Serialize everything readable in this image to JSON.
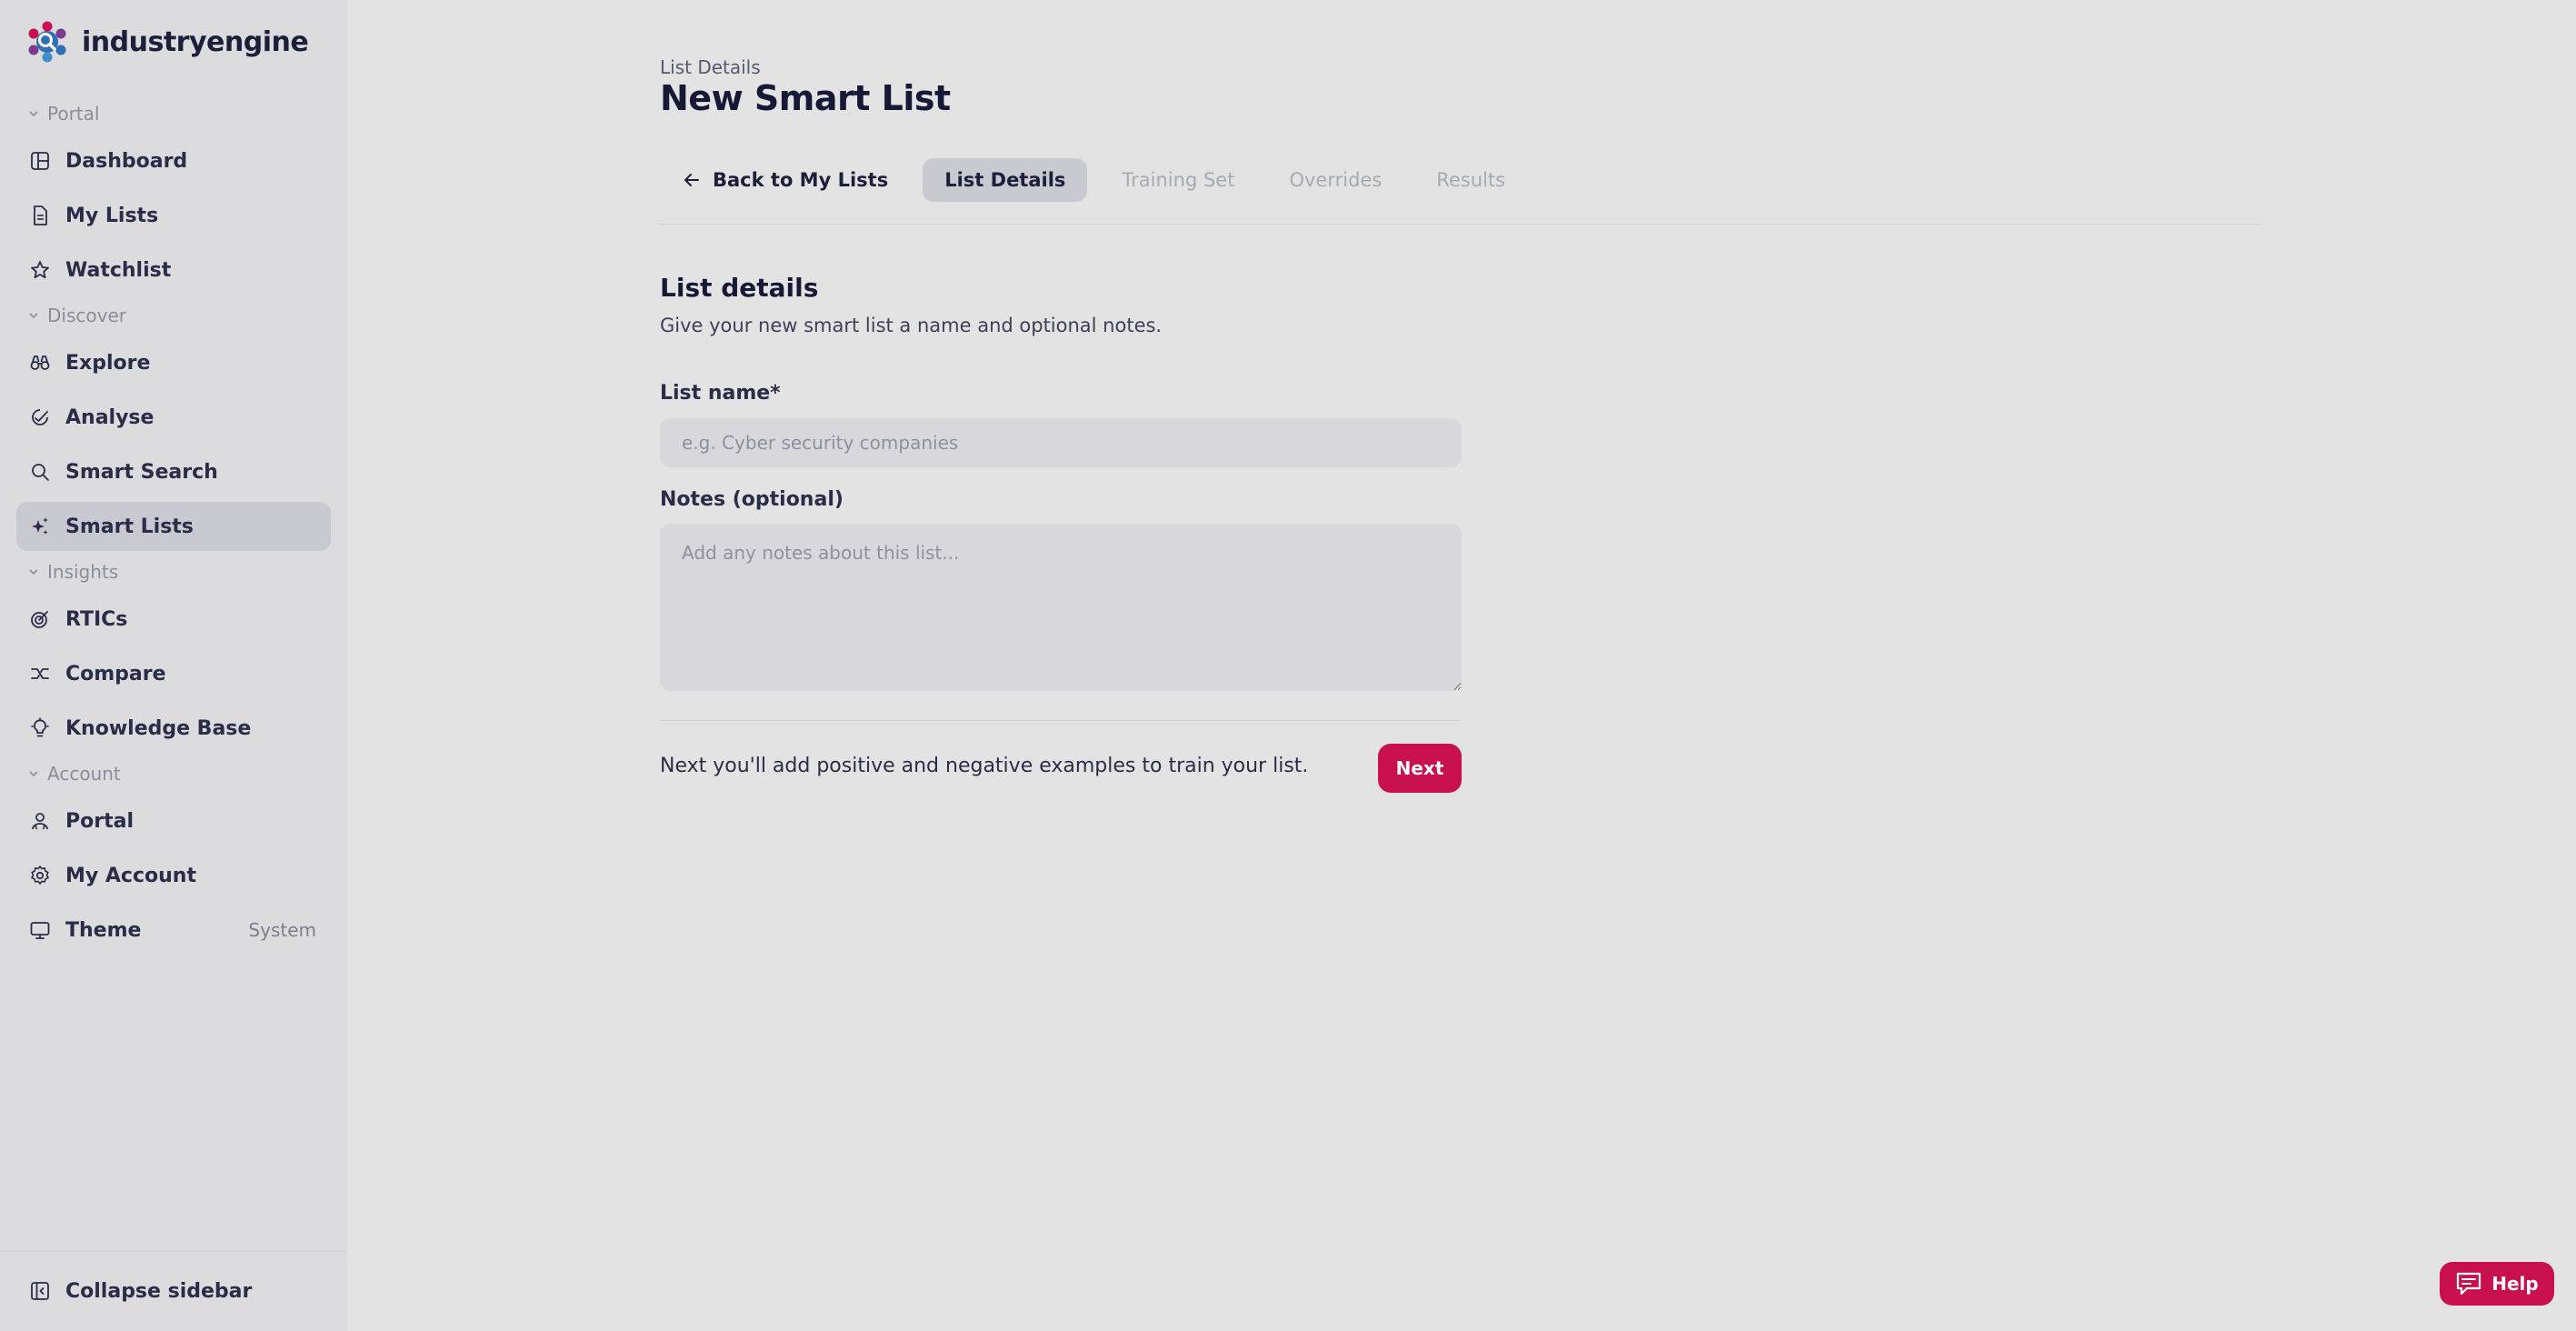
{
  "app": {
    "name": "industryengine"
  },
  "sidebar": {
    "sections": {
      "portal": "Portal",
      "discover": "Discover",
      "insights": "Insights",
      "account": "Account"
    },
    "items": {
      "dashboard": "Dashboard",
      "my_lists": "My Lists",
      "watchlist": "Watchlist",
      "explore": "Explore",
      "analyse": "Analyse",
      "smart_search": "Smart Search",
      "smart_lists": "Smart Lists",
      "rtics": "RTICs",
      "compare": "Compare",
      "knowledge_base": "Knowledge Base",
      "portal": "Portal",
      "my_account": "My Account",
      "theme": "Theme",
      "theme_value": "System"
    },
    "collapse": "Collapse sidebar",
    "active_item": "Smart Lists"
  },
  "header": {
    "breadcrumb": "List Details",
    "title": "New Smart List"
  },
  "tabs": {
    "back": "Back to My Lists",
    "list_details": "List Details",
    "training_set": "Training Set",
    "overrides": "Overrides",
    "results": "Results",
    "active": "List Details"
  },
  "form": {
    "section_title": "List details",
    "section_subtitle": "Give your new smart list a name and optional notes.",
    "list_name_label": "List name*",
    "list_name_placeholder": "e.g. Cyber security companies",
    "list_name_value": "",
    "notes_label": "Notes (optional)",
    "notes_placeholder": "Add any notes about this list...",
    "notes_value": "",
    "footer_note": "Next you'll add positive and negative examples to train your list.",
    "next_label": "Next"
  },
  "help": {
    "label": "Help"
  },
  "colors": {
    "accent": "#c8104f",
    "background": "#e3e3e3",
    "sidebar": "#dcdcdf",
    "active_item": "#c9c9d1"
  }
}
